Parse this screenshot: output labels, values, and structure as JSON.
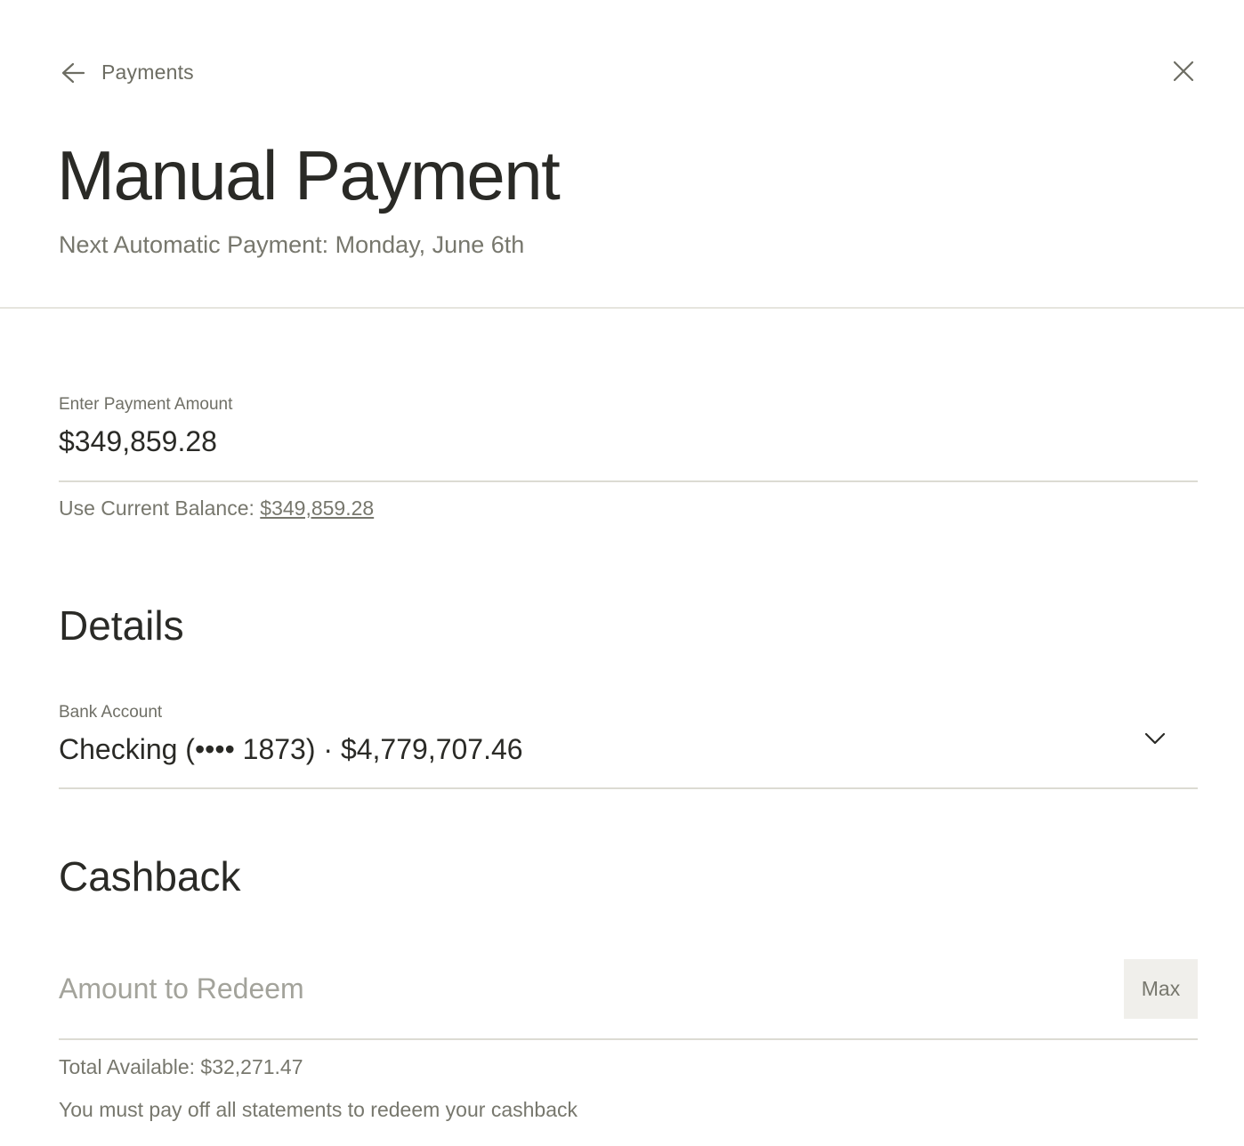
{
  "header": {
    "back_label": "Payments",
    "title": "Manual Payment",
    "subtitle": "Next Automatic Payment: Monday, June 6th"
  },
  "payment": {
    "label": "Enter Payment Amount",
    "value": "$349,859.28",
    "balance_prefix": "Use Current Balance: ",
    "balance_link": "$349,859.28"
  },
  "details": {
    "title": "Details",
    "bank_label": "Bank Account",
    "bank_value": "Checking (•••• 1873) · $4,779,707.46"
  },
  "cashback": {
    "title": "Cashback",
    "placeholder": "Amount to Redeem",
    "max_label": "Max",
    "total_available": "Total Available: $32,271.47",
    "note": "You must pay off all statements to redeem your cashback"
  },
  "icons": {
    "back": "arrow-left-icon",
    "close": "close-icon",
    "dropdown": "chevron-down-icon"
  },
  "colors": {
    "text_primary": "#2a2a26",
    "text_secondary": "#77776d",
    "divider": "#dcdbd3",
    "button_bg": "#f0efeb"
  }
}
